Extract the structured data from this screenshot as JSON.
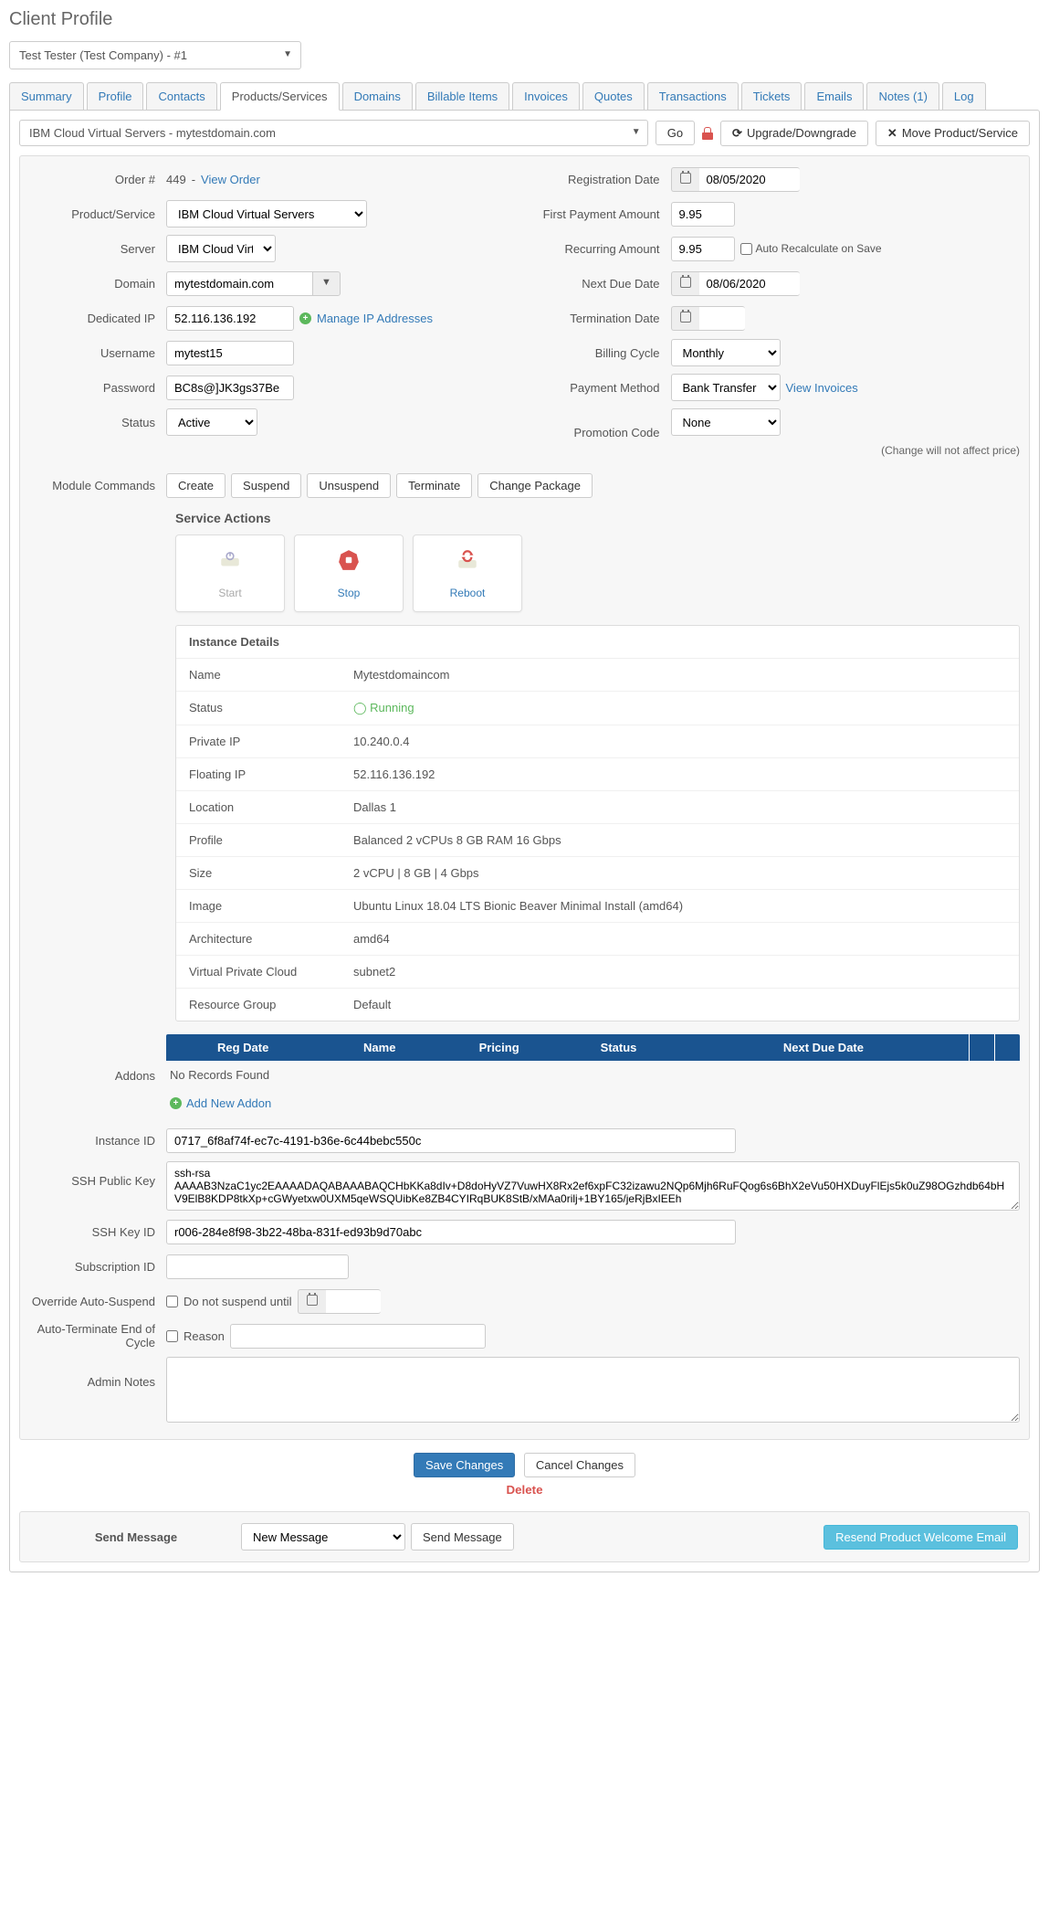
{
  "page_title": "Client Profile",
  "client_selected": "Test Tester (Test Company) - #1",
  "tabs": [
    "Summary",
    "Profile",
    "Contacts",
    "Products/Services",
    "Domains",
    "Billable Items",
    "Invoices",
    "Quotes",
    "Transactions",
    "Tickets",
    "Emails",
    "Notes (1)",
    "Log"
  ],
  "active_tab": "Products/Services",
  "product_selected": "IBM Cloud Virtual Servers - mytestdomain.com",
  "topbar": {
    "go": "Go",
    "upgrade": "Upgrade/Downgrade",
    "move": "Move Product/Service"
  },
  "left": {
    "order_label": "Order #",
    "order_num": "449",
    "view_order": "View Order",
    "product_service_label": "Product/Service",
    "product_service": "IBM Cloud Virtual Servers",
    "server_label": "Server",
    "server": "IBM Cloud Virtual Ser",
    "domain_label": "Domain",
    "domain": "mytestdomain.com",
    "dedicated_ip_label": "Dedicated IP",
    "dedicated_ip": "52.116.136.192",
    "manage_ip": "Manage IP Addresses",
    "username_label": "Username",
    "username": "mytest15",
    "password_label": "Password",
    "password": "BC8s@]JK3gs37Be",
    "status_label": "Status",
    "status": "Active"
  },
  "right": {
    "reg_date_label": "Registration Date",
    "reg_date": "08/05/2020",
    "first_pay_label": "First Payment Amount",
    "first_pay": "9.95",
    "recurring_label": "Recurring Amount",
    "recurring": "9.95",
    "auto_recalc": "Auto Recalculate on Save",
    "next_due_label": "Next Due Date",
    "next_due": "08/06/2020",
    "term_date_label": "Termination Date",
    "term_date": "",
    "billing_cycle_label": "Billing Cycle",
    "billing_cycle": "Monthly",
    "pay_method_label": "Payment Method",
    "pay_method": "Bank Transfer",
    "view_invoices": "View Invoices",
    "promo_label": "Promotion Code",
    "promo": "None",
    "promo_note": "(Change will not affect price)"
  },
  "module_commands_label": "Module Commands",
  "module_commands": [
    "Create",
    "Suspend",
    "Unsuspend",
    "Terminate",
    "Change Package"
  ],
  "service_actions_title": "Service Actions",
  "actions": {
    "start": "Start",
    "stop": "Stop",
    "reboot": "Reboot"
  },
  "instance": {
    "title": "Instance Details",
    "rows": [
      {
        "k": "Name",
        "v": "Mytestdomaincom"
      },
      {
        "k": "Status",
        "v": "Running",
        "running": true
      },
      {
        "k": "Private IP",
        "v": "10.240.0.4"
      },
      {
        "k": "Floating IP",
        "v": "52.116.136.192"
      },
      {
        "k": "Location",
        "v": "Dallas 1"
      },
      {
        "k": "Profile",
        "v": "Balanced 2 vCPUs 8 GB RAM 16 Gbps"
      },
      {
        "k": "Size",
        "v": "2 vCPU | 8 GB | 4 Gbps"
      },
      {
        "k": "Image",
        "v": "Ubuntu Linux 18.04 LTS Bionic Beaver Minimal Install (amd64)"
      },
      {
        "k": "Architecture",
        "v": "amd64"
      },
      {
        "k": "Virtual Private Cloud",
        "v": "subnet2"
      },
      {
        "k": "Resource Group",
        "v": "Default"
      }
    ]
  },
  "addons": {
    "label": "Addons",
    "headers": [
      "Reg Date",
      "Name",
      "Pricing",
      "Status",
      "Next Due Date"
    ],
    "no_records": "No Records Found",
    "add_new": "Add New Addon"
  },
  "custom": {
    "instance_id_label": "Instance ID",
    "instance_id": "0717_6f8af74f-ec7c-4191-b36e-6c44bebc550c",
    "ssh_pub_label": "SSH Public Key",
    "ssh_pub": "ssh-rsa AAAAB3NzaC1yc2EAAAADAQABAAABAQCHbKKa8dIv+D8doHyVZ7VuwHX8Rx2ef6xpFC32izawu2NQp6Mjh6RuFQog6s6BhX2eVu50HXDuyFlEjs5k0uZ98OGzhdb64bHV9ElB8KDP8tkXp+cGWyetxw0UXM5qeWSQUibKe8ZB4CYIRqBUK8StB/xMAa0rilj+1BY165/jeRjBxIEEh",
    "ssh_key_id_label": "SSH Key ID",
    "ssh_key_id": "r006-284e8f98-3b22-48ba-831f-ed93b9d70abc",
    "subscription_label": "Subscription ID",
    "subscription": "",
    "override_label": "Override Auto-Suspend",
    "override_text": "Do not suspend until",
    "autoterm_label": "Auto-Terminate End of Cycle",
    "autoterm_reason": "Reason",
    "admin_notes_label": "Admin Notes",
    "admin_notes": ""
  },
  "footer": {
    "save": "Save Changes",
    "cancel": "Cancel Changes",
    "delete": "Delete"
  },
  "send_msg": {
    "label": "Send Message",
    "select": "New Message",
    "btn": "Send Message",
    "resend": "Resend Product Welcome Email"
  }
}
